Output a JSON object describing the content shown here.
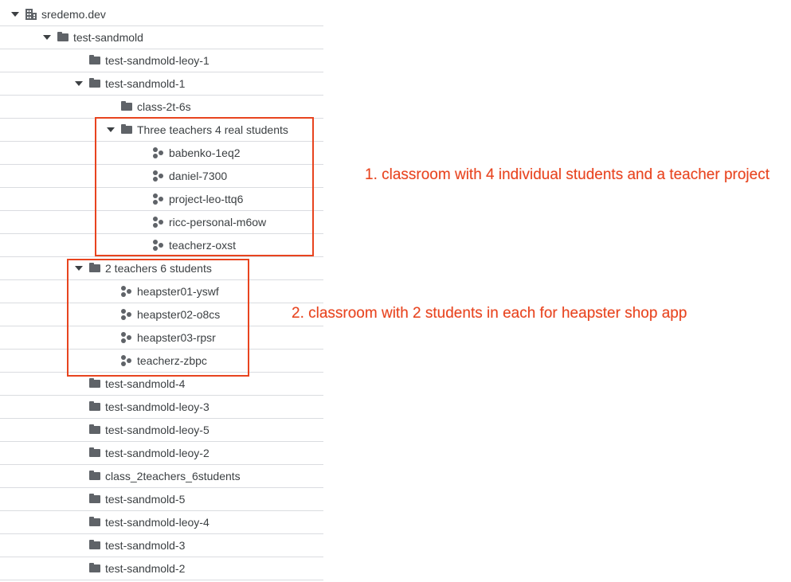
{
  "colors": {
    "annotation": "#e8441f",
    "icon": "#5f6368",
    "text": "#3c4043",
    "divider": "#dadce0"
  },
  "tree": [
    {
      "label": "sredemo.dev",
      "icon": "organization-icon",
      "level": 0,
      "expanded": true
    },
    {
      "label": "test-sandmold",
      "icon": "folder-icon",
      "level": 1,
      "expanded": true
    },
    {
      "label": "test-sandmold-leoy-1",
      "icon": "folder-icon",
      "level": 2,
      "expanded": false
    },
    {
      "label": "test-sandmold-1",
      "icon": "folder-icon",
      "level": 2,
      "expanded": true
    },
    {
      "label": "class-2t-6s",
      "icon": "folder-icon",
      "level": 3,
      "expanded": false
    },
    {
      "label": "Three teachers 4 real students",
      "icon": "folder-icon",
      "level": 3,
      "expanded": true
    },
    {
      "label": "babenko-1eq2",
      "icon": "project-icon",
      "level": 4
    },
    {
      "label": "daniel-7300",
      "icon": "project-icon",
      "level": 4
    },
    {
      "label": "project-leo-ttq6",
      "icon": "project-icon",
      "level": 4
    },
    {
      "label": "ricc-personal-m6ow",
      "icon": "project-icon",
      "level": 4
    },
    {
      "label": "teacherz-oxst",
      "icon": "project-icon",
      "level": 4
    },
    {
      "label": "2 teachers 6 students",
      "icon": "folder-icon",
      "level": 2,
      "expanded": true
    },
    {
      "label": "heapster01-yswf",
      "icon": "project-icon",
      "level": 3
    },
    {
      "label": "heapster02-o8cs",
      "icon": "project-icon",
      "level": 3
    },
    {
      "label": "heapster03-rpsr",
      "icon": "project-icon",
      "level": 3
    },
    {
      "label": "teacherz-zbpc",
      "icon": "project-icon",
      "level": 3
    },
    {
      "label": "test-sandmold-4",
      "icon": "folder-icon",
      "level": 2,
      "expanded": false
    },
    {
      "label": "test-sandmold-leoy-3",
      "icon": "folder-icon",
      "level": 2,
      "expanded": false
    },
    {
      "label": "test-sandmold-leoy-5",
      "icon": "folder-icon",
      "level": 2,
      "expanded": false
    },
    {
      "label": "test-sandmold-leoy-2",
      "icon": "folder-icon",
      "level": 2,
      "expanded": false
    },
    {
      "label": "class_2teachers_6students",
      "icon": "folder-icon",
      "level": 2,
      "expanded": false
    },
    {
      "label": "test-sandmold-5",
      "icon": "folder-icon",
      "level": 2,
      "expanded": false
    },
    {
      "label": "test-sandmold-leoy-4",
      "icon": "folder-icon",
      "level": 2,
      "expanded": false
    },
    {
      "label": "test-sandmold-3",
      "icon": "folder-icon",
      "level": 2,
      "expanded": false
    },
    {
      "label": "test-sandmold-2",
      "icon": "folder-icon",
      "level": 2,
      "expanded": false
    }
  ],
  "annotations": {
    "first": "1. classroom with 4 individual students and a teacher project",
    "second": "2. classroom with 2 students in each for heapster shop app"
  }
}
